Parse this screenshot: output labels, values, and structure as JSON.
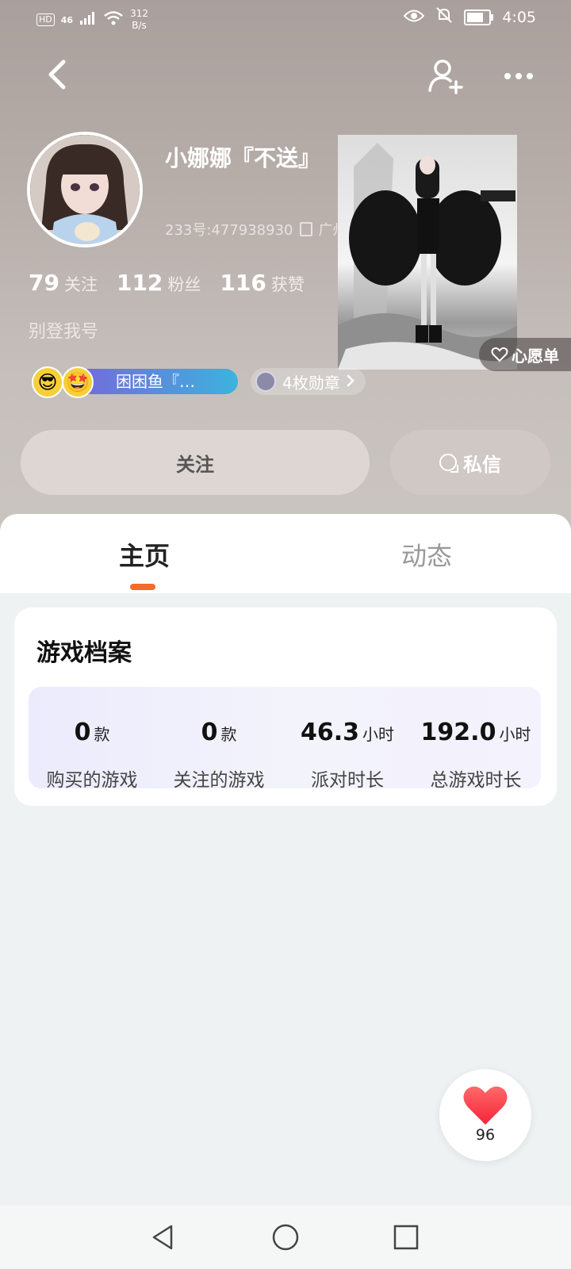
{
  "status_bar": {
    "hd": "HD",
    "network": "46",
    "speed_value": "312",
    "speed_unit": "B/s",
    "time": "4:05"
  },
  "profile": {
    "name": "小娜娜『不送』",
    "id_label": "233号:477938930",
    "id_suffix": "广州",
    "bio": "别登我号"
  },
  "stats": [
    {
      "value": "79",
      "label": "关注"
    },
    {
      "value": "112",
      "label": "粉丝"
    },
    {
      "value": "116",
      "label": "获赞"
    }
  ],
  "wishlist_label": "心愿单",
  "title_badge_text": "困困鱼『…",
  "medals_label": "4枚勋章",
  "follow_label": "关注",
  "message_label": "私信",
  "tabs": [
    "主页",
    "动态"
  ],
  "card": {
    "title": "游戏档案",
    "items": [
      {
        "value": "0",
        "unit": "款",
        "label": "购买的游戏"
      },
      {
        "value": "0",
        "unit": "款",
        "label": "关注的游戏"
      },
      {
        "value": "46.3",
        "unit": "小时",
        "label": "派对时长"
      },
      {
        "value": "192.0",
        "unit": "小时",
        "label": "总游戏时长"
      }
    ]
  },
  "like_count": "96",
  "colors": {
    "accent": "#f46c2a",
    "heart": "#ff3b47"
  }
}
